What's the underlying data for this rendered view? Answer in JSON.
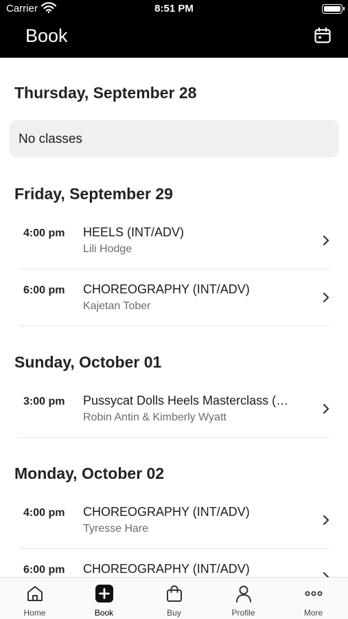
{
  "status_bar": {
    "carrier": "Carrier",
    "time": "8:51 PM"
  },
  "header": {
    "title": "Book",
    "calendar_icon": "calendar-icon"
  },
  "days": [
    {
      "label": "Thursday, September 28",
      "empty_text": "No classes",
      "classes": []
    },
    {
      "label": "Friday, September 29",
      "classes": [
        {
          "time": "4:00 pm",
          "name": "HEELS (INT/ADV)",
          "instructor": "Lili Hodge"
        },
        {
          "time": "6:00 pm",
          "name": "CHOREOGRAPHY (INT/ADV)",
          "instructor": "Kajetan Tober"
        }
      ]
    },
    {
      "label": "Sunday, October 01",
      "classes": [
        {
          "time": "3:00 pm",
          "name": "Pussycat Dolls Heels Masterclass (…",
          "instructor": "Robin Antin & Kimberly Wyatt"
        }
      ]
    },
    {
      "label": "Monday, October 02",
      "classes": [
        {
          "time": "4:00 pm",
          "name": "CHOREOGRAPHY (INT/ADV)",
          "instructor": "Tyresse Hare"
        },
        {
          "time": "6:00 pm",
          "name": "CHOREOGRAPHY (INT/ADV)",
          "instructor": ""
        }
      ]
    }
  ],
  "tab_bar": {
    "active": "Book",
    "tabs": [
      {
        "label": "Home",
        "icon": "home-icon"
      },
      {
        "label": "Book",
        "icon": "plus-square-icon"
      },
      {
        "label": "Buy",
        "icon": "shopping-bag-icon"
      },
      {
        "label": "Profile",
        "icon": "person-icon"
      },
      {
        "label": "More",
        "icon": "more-dots-icon"
      }
    ]
  },
  "colors": {
    "header_bg": "#000000",
    "accent": "#000000",
    "card_bg": "#f0f0f2"
  }
}
